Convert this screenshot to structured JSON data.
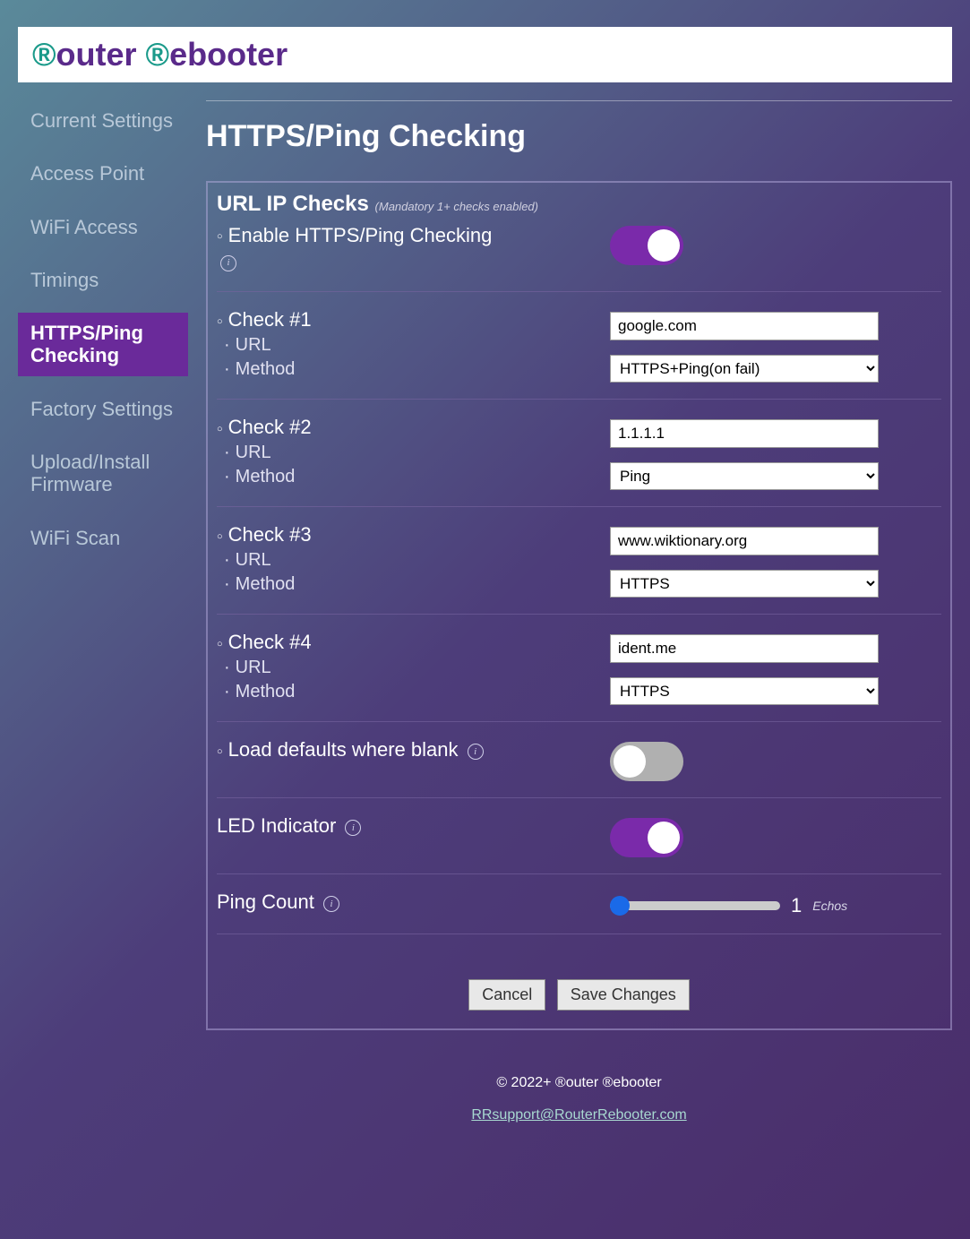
{
  "app": {
    "title_html": "®outer ®ebooter"
  },
  "sidebar": {
    "items": [
      {
        "label": "Current Settings",
        "active": false
      },
      {
        "label": "Access Point",
        "active": false
      },
      {
        "label": "WiFi Access",
        "active": false
      },
      {
        "label": "Timings",
        "active": false
      },
      {
        "label": "HTTPS/Ping Checking",
        "active": true
      },
      {
        "label": "Factory Settings",
        "active": false
      },
      {
        "label": "Upload/Install Firmware",
        "active": false
      },
      {
        "label": "WiFi Scan",
        "active": false
      }
    ]
  },
  "page": {
    "title": "HTTPS/Ping Checking",
    "section_title": "URL IP Checks",
    "section_hint": "(Mandatory 1+ checks enabled)",
    "enable_label": "Enable HTTPS/Ping Checking",
    "enable_on": true,
    "url_label": "URL",
    "method_label": "Method",
    "method_options": [
      "HTTPS+Ping(on fail)",
      "Ping",
      "HTTPS"
    ],
    "checks": [
      {
        "title": "Check #1",
        "url": "google.com",
        "method": "HTTPS+Ping(on fail)"
      },
      {
        "title": "Check #2",
        "url": "1.1.1.1",
        "method": "Ping"
      },
      {
        "title": "Check #3",
        "url": "www.wiktionary.org",
        "method": "HTTPS"
      },
      {
        "title": "Check #4",
        "url": "ident.me",
        "method": "HTTPS"
      }
    ],
    "load_defaults_label": "Load defaults where blank",
    "load_defaults_on": false,
    "led_label": "LED Indicator",
    "led_on": true,
    "ping_count_label": "Ping Count",
    "ping_count_value": 1,
    "ping_count_min": 1,
    "ping_count_max": 10,
    "ping_count_unit": "Echos",
    "cancel_label": "Cancel",
    "save_label": "Save Changes"
  },
  "footer": {
    "copyright": "© 2022+ ®outer ®ebooter",
    "email": "RRsupport@RouterRebooter.com"
  }
}
